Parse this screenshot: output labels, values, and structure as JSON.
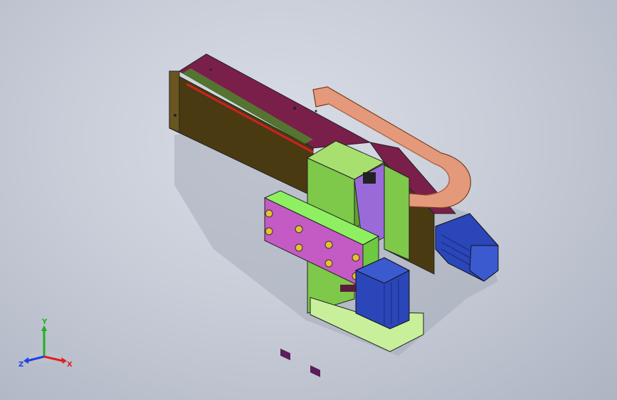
{
  "triad": {
    "x_label": "X",
    "y_label": "Y",
    "z_label": "Z",
    "x_color": "#e02020",
    "y_color": "#20b020",
    "z_color": "#2040e0"
  },
  "colors": {
    "background": "#c8cdd8",
    "beam_face": "#4a3a12",
    "beam_top": "#7a1e4a",
    "carrier_arm": "#e49a7a",
    "green_block": "#7ec84a",
    "purple_plate": "#9a6ad8",
    "magenta_fixture": "#c45ac4",
    "motor": "#2a46b8",
    "light_green_base": "#c8f09a"
  }
}
